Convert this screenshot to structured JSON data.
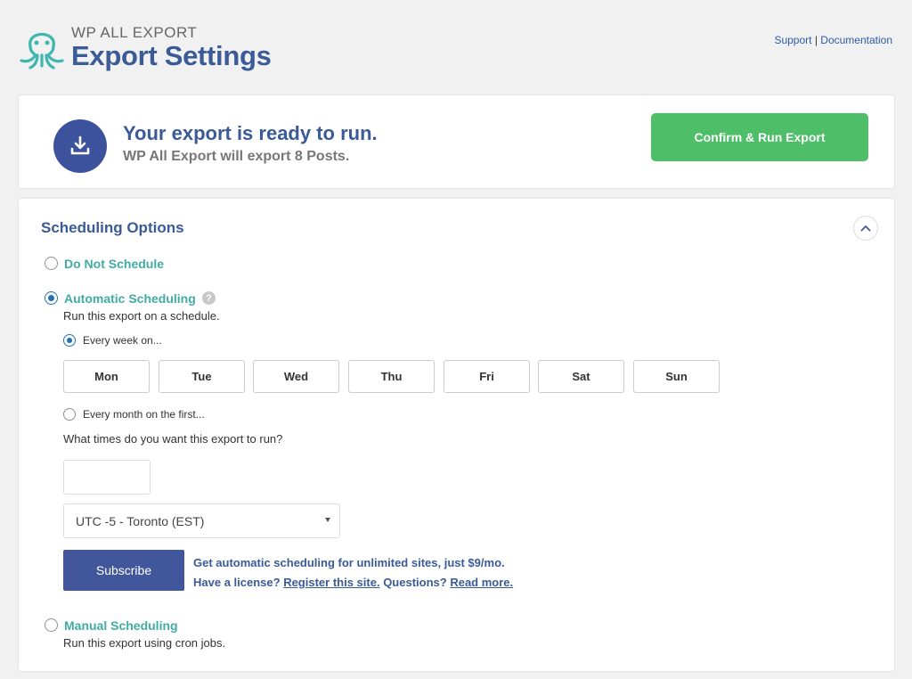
{
  "header": {
    "brand_small": "WP ALL EXPORT",
    "title": "Export Settings",
    "support_link": "Support",
    "separator": "|",
    "documentation_link": "Documentation"
  },
  "ready": {
    "title": "Your export is ready to run.",
    "subtitle": "WP All Export will export 8 Posts.",
    "run_button": "Confirm & Run Export"
  },
  "scheduling": {
    "title": "Scheduling Options",
    "do_not_schedule": "Do Not Schedule",
    "automatic": {
      "label": "Automatic Scheduling",
      "help": "?",
      "description": "Run this export on a schedule.",
      "every_week": "Every week on...",
      "days": [
        "Mon",
        "Tue",
        "Wed",
        "Thu",
        "Fri",
        "Sat",
        "Sun"
      ],
      "every_month": "Every month on the first...",
      "times_question": "What times do you want this export to run?",
      "time_value": "",
      "timezone": "UTC -5 - Toronto (EST)",
      "subscribe_button": "Subscribe",
      "promo_line1": "Get automatic scheduling for unlimited sites, just $9/mo.",
      "promo_have_license": "Have a license?",
      "promo_register": "Register this site.",
      "promo_questions": "Questions?",
      "promo_read_more": "Read more."
    },
    "manual": {
      "label": "Manual Scheduling",
      "description": "Run this export using cron jobs."
    },
    "selected_option": "automatic",
    "selected_frequency": "weekly"
  },
  "colors": {
    "brand_blue": "#3a5a98",
    "teal": "#40aca4",
    "green": "#4fbe68",
    "subscribe": "#42569c"
  }
}
